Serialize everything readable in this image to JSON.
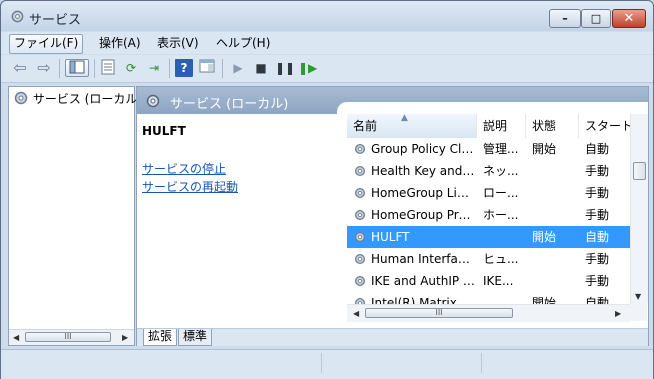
{
  "window": {
    "title": "サービス",
    "min": "–",
    "max": "□",
    "close": "✕"
  },
  "menu": [
    "ファイル(F)",
    "操作(A)",
    "表示(V)",
    "ヘルプ(H)"
  ],
  "tree": {
    "root_label": "サービス (ローカル)"
  },
  "details": {
    "header_title": "サービス (ローカル)",
    "service_name": "HULFT",
    "links": [
      "サービスの停止",
      "サービスの再起動"
    ]
  },
  "columns": [
    "名前",
    "説明",
    "状態",
    "スタートアップの種類"
  ],
  "rows": [
    {
      "name": "Group Policy Client",
      "desc": "管理...",
      "status": "開始",
      "startup": "自動"
    },
    {
      "name": "Health Key and Certificate Management",
      "desc": "ネッ...",
      "status": "",
      "startup": "手動"
    },
    {
      "name": "HomeGroup Listener",
      "desc": "ロー...",
      "status": "",
      "startup": "手動"
    },
    {
      "name": "HomeGroup Provider",
      "desc": "ホー...",
      "status": "",
      "startup": "手動"
    },
    {
      "name": "HULFT",
      "desc": "",
      "status": "開始",
      "startup": "自動",
      "selected": true
    },
    {
      "name": "Human Interface Device Access",
      "desc": "ヒュ...",
      "status": "",
      "startup": "手動"
    },
    {
      "name": "IKE and AuthIP IPsec Keying Modules",
      "desc": "IKE...",
      "status": "",
      "startup": "手動"
    },
    {
      "name": "Intel(R) Matrix Storage Event Monitor",
      "desc": "",
      "status": "開始",
      "startup": "自動"
    }
  ],
  "tabs": [
    "拡張",
    "標準"
  ],
  "colors": {
    "selection": "#3399ff",
    "link": "#1a56b0",
    "header": "#8ea5c2"
  }
}
